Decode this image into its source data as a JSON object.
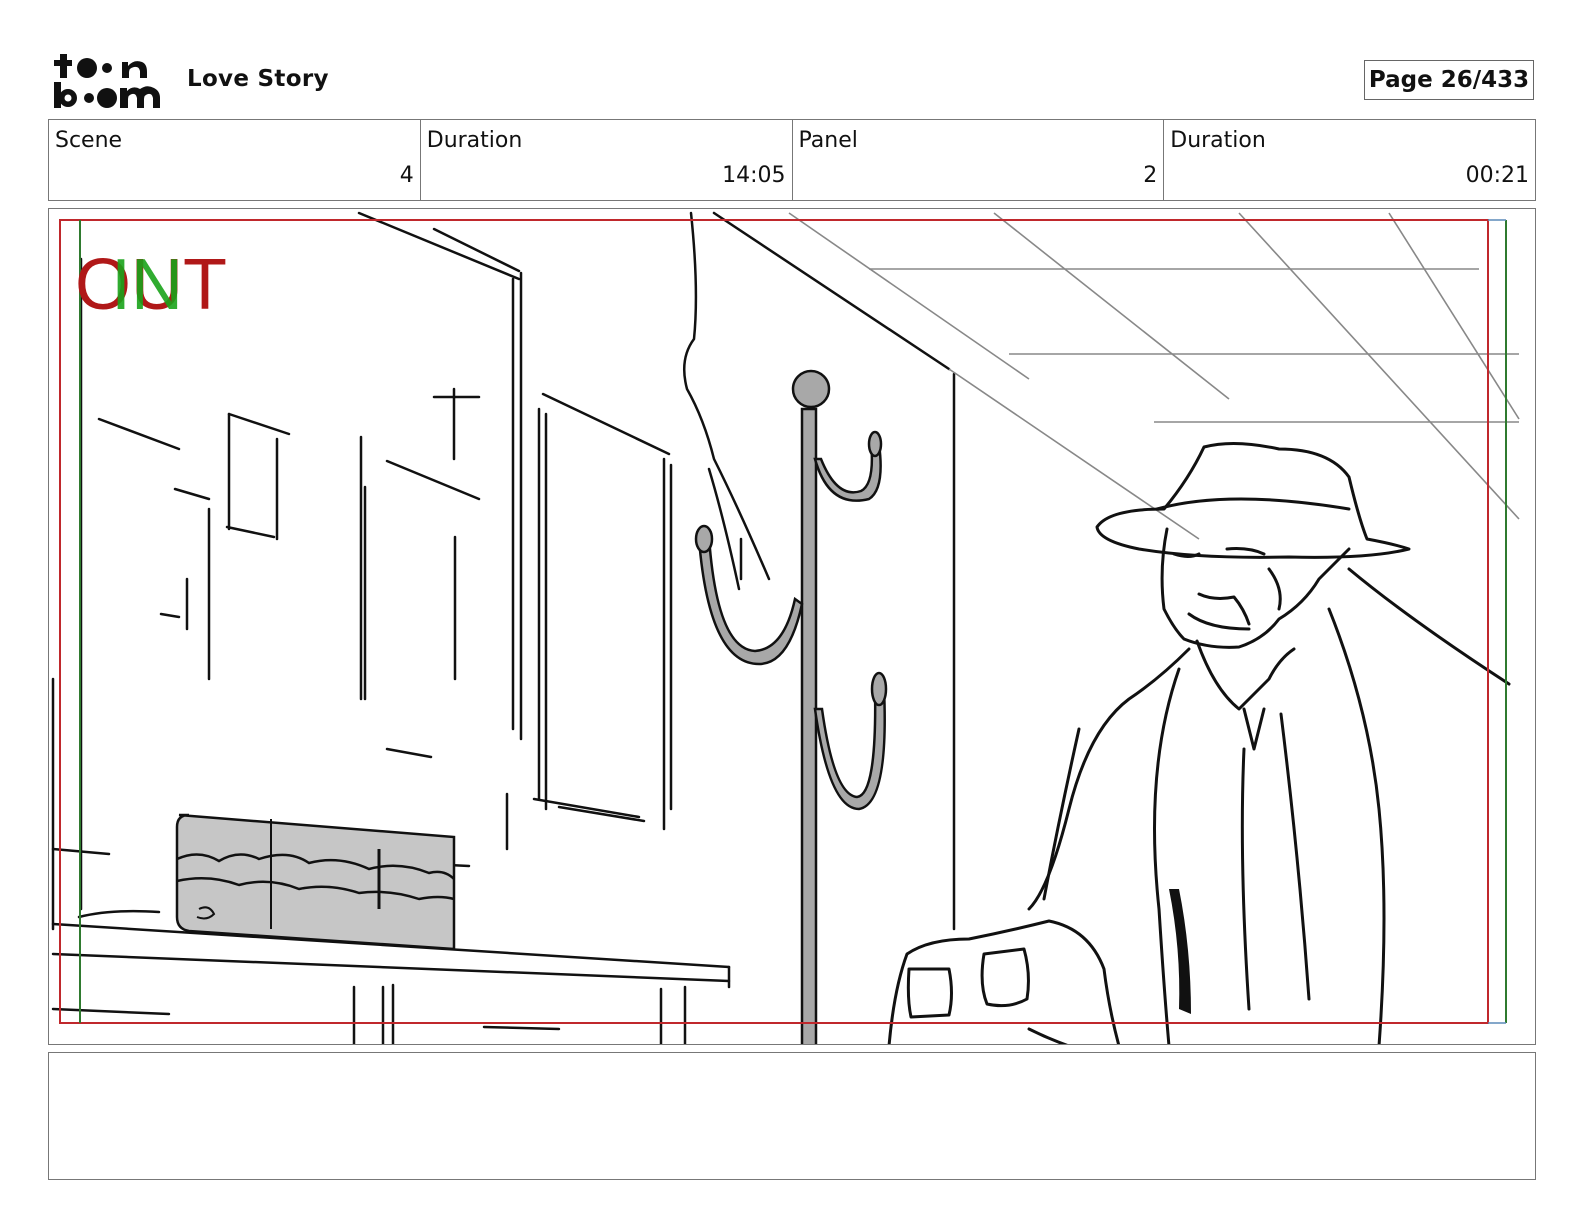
{
  "header": {
    "logo_text": "toon boom",
    "project_title": "Love Story",
    "page_label": "Page",
    "page_number": "26/433"
  },
  "info": {
    "scene_label": "Scene",
    "scene_value": "4",
    "scene_duration_label": "Duration",
    "scene_duration_value": "14:05",
    "panel_label": "Panel",
    "panel_value": "2",
    "panel_duration_label": "Duration",
    "panel_duration_value": "00:21"
  },
  "panel": {
    "out_marker": "OUT",
    "in_marker": "IN",
    "out_color": "#b01818",
    "in_color": "#1aa31a",
    "frame_red": "#c0282c",
    "frame_green": "#2f7a2f"
  },
  "notes": {
    "dialogue": "",
    "action": ""
  }
}
